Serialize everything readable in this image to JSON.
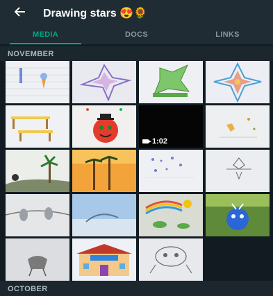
{
  "header": {
    "title": "Drawing stars 😍🌻"
  },
  "tabs": [
    {
      "label": "MEDIA",
      "active": true
    },
    {
      "label": "DOCS",
      "active": false
    },
    {
      "label": "LINKS",
      "active": false
    }
  ],
  "sections": {
    "november": "NOVEMBER",
    "october": "OCTOBER"
  },
  "media": {
    "video_duration": "1:02"
  },
  "colors": {
    "header_bg": "#1f2c33",
    "body_bg": "#121b22",
    "accent": "#00a884",
    "tab_inactive": "#8696a0"
  }
}
